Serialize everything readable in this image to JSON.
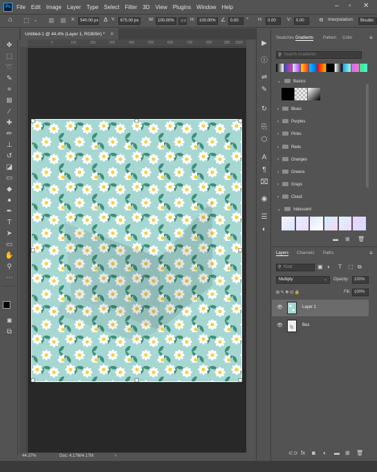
{
  "menu": {
    "logo": "Ps",
    "items": [
      "File",
      "Edit",
      "Image",
      "Layer",
      "Type",
      "Select",
      "Filter",
      "3D",
      "View",
      "Plugins",
      "Window",
      "Help"
    ]
  },
  "options": {
    "x_label": "X:",
    "x_value": "540.00 px",
    "y_label": "Y:",
    "y_value": "675.00 px",
    "w_label": "W:",
    "w_value": "100.00%",
    "h_label": "H:",
    "h_value": "100.00%",
    "angle_value": "0.00",
    "hskew_label": "H:",
    "hskew_value": "0.00",
    "v_label": "V:",
    "v_value": "0.00",
    "interpolation_label": "Interpolation:",
    "interpolation_value": "Bicubic"
  },
  "document": {
    "tab_title": "Untitled-1 @ 44.4% (Layer 1, RGB/8#) *",
    "ruler_ticks": [
      "0",
      "100",
      "200",
      "300",
      "400",
      "500",
      "600",
      "700",
      "800",
      "900",
      "1000"
    ],
    "zoom": "44.37%",
    "doc_size": "Doc: 4.17M/4.17M"
  },
  "gradients_panel": {
    "tabs": [
      "Swatches",
      "Gradients",
      "Pattern",
      "Color"
    ],
    "active_tab": "Gradients",
    "search_placeholder": "Search Gradients",
    "folders": [
      "Basics",
      "Blues",
      "Purples",
      "Pinks",
      "Reds",
      "Oranges",
      "Greens",
      "Grays",
      "Cloud",
      "Iridescent"
    ]
  },
  "layers_panel": {
    "tabs": [
      "Layers",
      "Channels",
      "Paths"
    ],
    "active_tab": "Layers",
    "filter_placeholder": "Kind",
    "blend_mode": "Multiply",
    "opacity_label": "Opacity:",
    "opacity_value": "100%",
    "fill_label": "Fill:",
    "fill_value": "100%",
    "layers": [
      {
        "name": "Layer 1",
        "selected": true
      },
      {
        "name": "Box",
        "selected": false
      }
    ]
  },
  "colors": {
    "pattern_bg": "#a6d7d3",
    "leaf": "#3f8f77",
    "petal": "#ffffff",
    "flower_center": "#f4d13f",
    "accent_blue": "#31a8ff"
  }
}
